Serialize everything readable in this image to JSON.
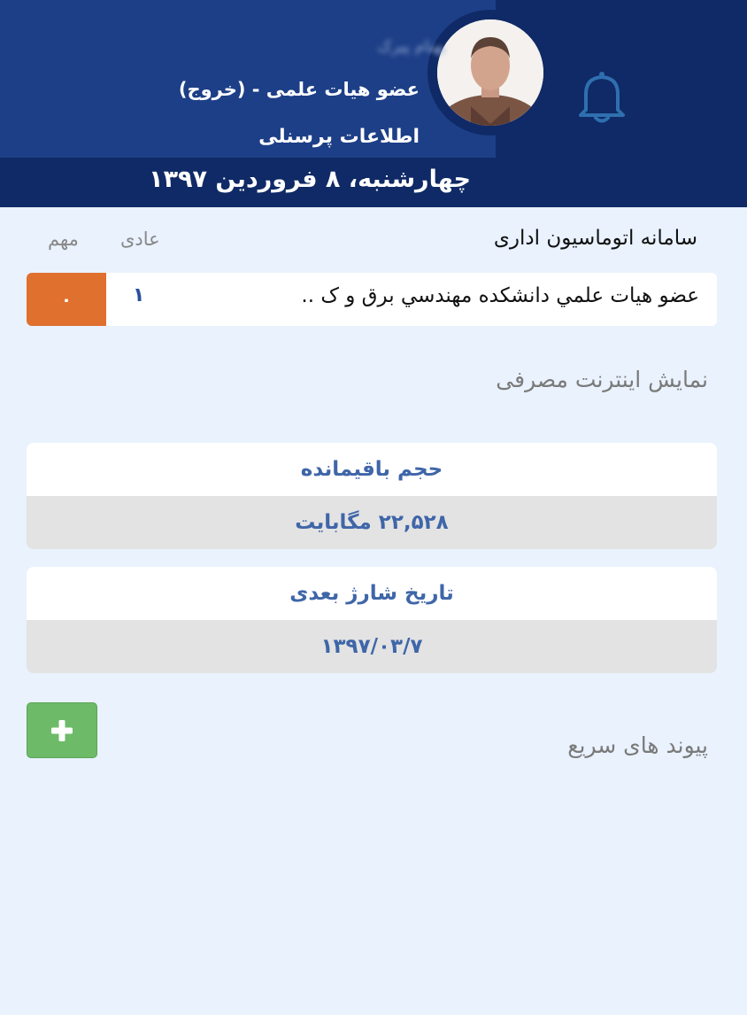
{
  "header": {
    "user_name": "بهنام پیرک",
    "role_logout": "عضو هیات علمی - (خروج)",
    "personal_info": "اطلاعات پرسنلی",
    "date": "چهارشنبه، ۸ فروردین ۱۳۹۷",
    "bell_icon": "bell-icon",
    "avatar": "user-avatar"
  },
  "office_system": {
    "title": "سامانه اتوماسیون اداری",
    "col_normal": "عادی",
    "col_important": "مهم",
    "rows": [
      {
        "label": "عضو هيات علمي دانشکده مهندسي برق و ک ..",
        "normal": "۱",
        "important": "۰"
      }
    ]
  },
  "internet": {
    "title": "نمایش اینترنت مصرفی",
    "remaining_label": "حجم باقیمانده",
    "remaining_value": "۲۲,۵۲۸ مگابایت",
    "next_charge_label": "تاریخ شارژ بعدی",
    "next_charge_value": "۱۳۹۷/۰۳/۷"
  },
  "quick_links": {
    "title": "پیوند های سریع",
    "add_icon": "plus-icon"
  },
  "colors": {
    "header_blue": "#1d3f87",
    "header_dark": "#0f2a66",
    "important_orange": "#e0702e",
    "add_green": "#6dbb69"
  }
}
